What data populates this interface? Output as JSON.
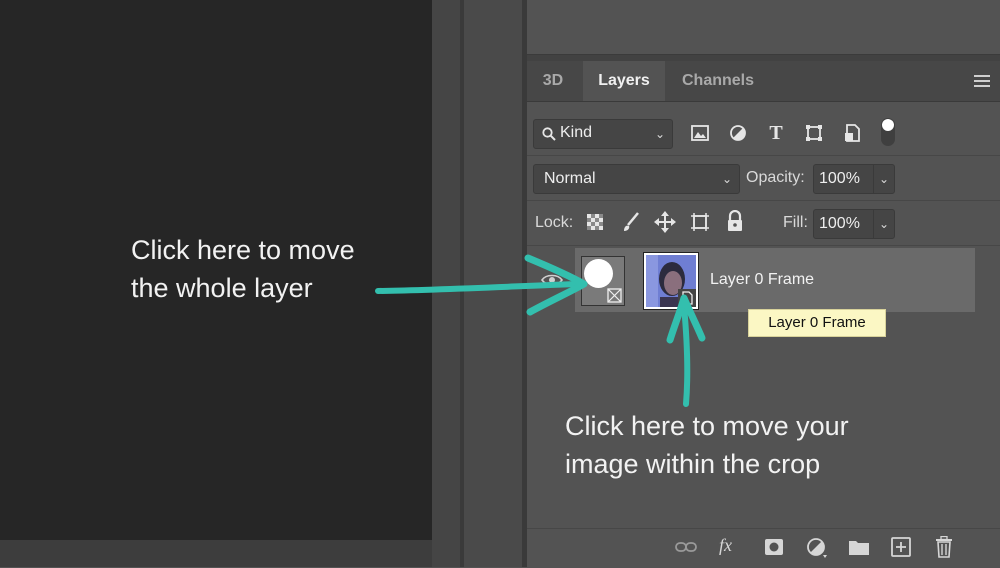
{
  "tabs": [
    {
      "label": "3D",
      "active": false
    },
    {
      "label": "Layers",
      "active": true
    },
    {
      "label": "Channels",
      "active": false
    }
  ],
  "filter": {
    "label": "Kind"
  },
  "filter_icons": [
    "image-filter-icon",
    "adjustment-filter-icon",
    "type-filter-icon",
    "shape-filter-icon",
    "smart-object-filter-icon",
    "filter-toggle-icon"
  ],
  "blend": {
    "mode": "Normal",
    "opacity_label": "Opacity:",
    "opacity_value": "100%"
  },
  "lock": {
    "label": "Lock:",
    "fill_label": "Fill:",
    "fill_value": "100%"
  },
  "layer": {
    "name": "Layer 0 Frame"
  },
  "tooltip": "Layer 0 Frame",
  "annotations": {
    "left": [
      "Click here to move",
      "the whole layer"
    ],
    "right": [
      "Click here to move your",
      "image within the crop"
    ]
  },
  "bottom_icons": [
    "link-layers-icon",
    "fx-icon",
    "add-mask-icon",
    "adjustment-layer-icon",
    "new-group-icon",
    "new-layer-icon",
    "trash-icon"
  ],
  "bottom_fx_label": "fx",
  "colors": {
    "accent_arrow": "#33bfae",
    "tooltip_bg": "#fbf7c4"
  }
}
